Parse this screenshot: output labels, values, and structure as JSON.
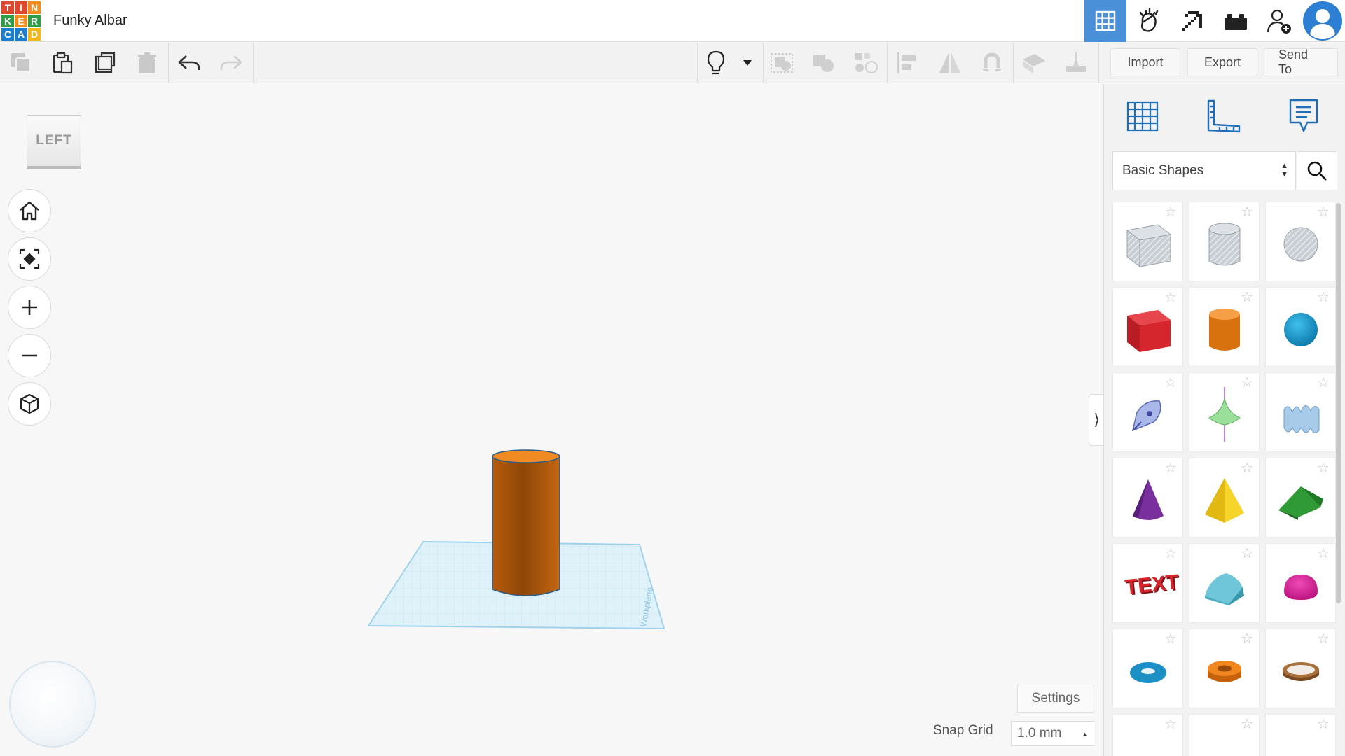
{
  "app": {
    "logo_letters": [
      "T",
      "I",
      "N",
      "K",
      "E",
      "R",
      "C",
      "A",
      "D"
    ],
    "logo_colors": [
      "#e0472f",
      "#e0472f",
      "#f38d1f",
      "#2f9e48",
      "#f38d1f",
      "#2f9e48",
      "#1d7ecf",
      "#1d7ecf",
      "#f6b71d"
    ],
    "project_name": "Funky Albar"
  },
  "top_icons": [
    {
      "name": "3d-design-grid-icon",
      "active": true
    },
    {
      "name": "circuits-hand-icon",
      "active": false
    },
    {
      "name": "minecraft-pickaxe-icon",
      "active": false
    },
    {
      "name": "bricks-icon",
      "active": false
    },
    {
      "name": "invite-user-icon",
      "active": false
    },
    {
      "name": "user-avatar-icon",
      "active": false
    }
  ],
  "toolbar": {
    "copy_icon": "copy-icon",
    "paste_icon": "paste-icon",
    "duplicate_icon": "duplicate-icon",
    "delete_icon": "trash-icon",
    "undo_icon": "undo-icon",
    "redo_icon": "redo-icon",
    "hint_icon": "lightbulb-icon",
    "import_label": "Import",
    "export_label": "Export",
    "send_to_label": "Send To"
  },
  "viewport": {
    "view_cube_label": "LEFT",
    "nav_buttons": [
      "home-icon",
      "fit-view-icon",
      "zoom-in-icon",
      "zoom-out-icon",
      "perspective-cube-icon"
    ],
    "workplane_label": "Workplane",
    "settings_label": "Settings",
    "snap_grid_label": "Snap Grid",
    "snap_grid_value": "1.0 mm"
  },
  "panel": {
    "icons": [
      "workplane-grid-icon",
      "ruler-icon",
      "notes-icon"
    ],
    "library_selected": "Basic Shapes",
    "shapes": [
      "box-hole",
      "cylinder-hole",
      "sphere-hole",
      "box",
      "cylinder",
      "sphere",
      "scribble",
      "shape-generator",
      "wavy-text",
      "cone",
      "pyramid",
      "roof",
      "text",
      "round-roof",
      "half-sphere",
      "torus",
      "tube",
      "ring"
    ]
  },
  "colors": {
    "accent": "#4a90d9",
    "cylinder": "#d4720f",
    "workplane": "#dff1f9"
  }
}
